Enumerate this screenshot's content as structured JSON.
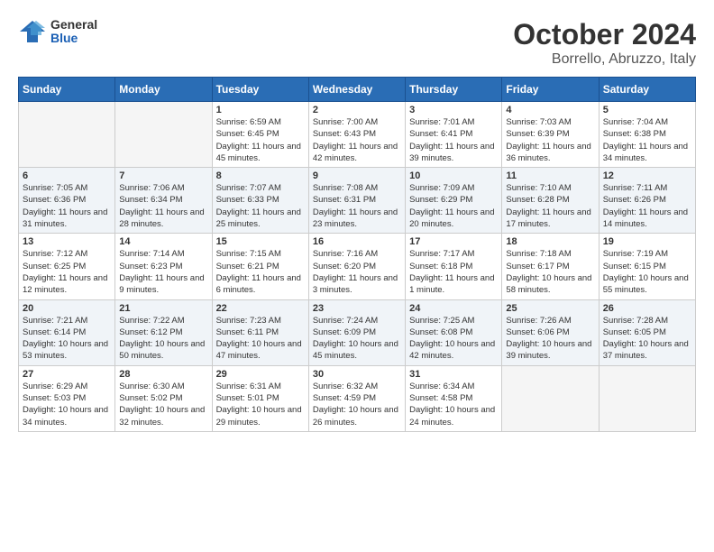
{
  "logo": {
    "general": "General",
    "blue": "Blue"
  },
  "header": {
    "month": "October 2024",
    "location": "Borrello, Abruzzo, Italy"
  },
  "weekdays": [
    "Sunday",
    "Monday",
    "Tuesday",
    "Wednesday",
    "Thursday",
    "Friday",
    "Saturday"
  ],
  "weeks": [
    [
      {
        "day": "",
        "empty": true
      },
      {
        "day": "",
        "empty": true
      },
      {
        "day": "1",
        "sunrise": "Sunrise: 6:59 AM",
        "sunset": "Sunset: 6:45 PM",
        "daylight": "Daylight: 11 hours and 45 minutes."
      },
      {
        "day": "2",
        "sunrise": "Sunrise: 7:00 AM",
        "sunset": "Sunset: 6:43 PM",
        "daylight": "Daylight: 11 hours and 42 minutes."
      },
      {
        "day": "3",
        "sunrise": "Sunrise: 7:01 AM",
        "sunset": "Sunset: 6:41 PM",
        "daylight": "Daylight: 11 hours and 39 minutes."
      },
      {
        "day": "4",
        "sunrise": "Sunrise: 7:03 AM",
        "sunset": "Sunset: 6:39 PM",
        "daylight": "Daylight: 11 hours and 36 minutes."
      },
      {
        "day": "5",
        "sunrise": "Sunrise: 7:04 AM",
        "sunset": "Sunset: 6:38 PM",
        "daylight": "Daylight: 11 hours and 34 minutes."
      }
    ],
    [
      {
        "day": "6",
        "sunrise": "Sunrise: 7:05 AM",
        "sunset": "Sunset: 6:36 PM",
        "daylight": "Daylight: 11 hours and 31 minutes."
      },
      {
        "day": "7",
        "sunrise": "Sunrise: 7:06 AM",
        "sunset": "Sunset: 6:34 PM",
        "daylight": "Daylight: 11 hours and 28 minutes."
      },
      {
        "day": "8",
        "sunrise": "Sunrise: 7:07 AM",
        "sunset": "Sunset: 6:33 PM",
        "daylight": "Daylight: 11 hours and 25 minutes."
      },
      {
        "day": "9",
        "sunrise": "Sunrise: 7:08 AM",
        "sunset": "Sunset: 6:31 PM",
        "daylight": "Daylight: 11 hours and 23 minutes."
      },
      {
        "day": "10",
        "sunrise": "Sunrise: 7:09 AM",
        "sunset": "Sunset: 6:29 PM",
        "daylight": "Daylight: 11 hours and 20 minutes."
      },
      {
        "day": "11",
        "sunrise": "Sunrise: 7:10 AM",
        "sunset": "Sunset: 6:28 PM",
        "daylight": "Daylight: 11 hours and 17 minutes."
      },
      {
        "day": "12",
        "sunrise": "Sunrise: 7:11 AM",
        "sunset": "Sunset: 6:26 PM",
        "daylight": "Daylight: 11 hours and 14 minutes."
      }
    ],
    [
      {
        "day": "13",
        "sunrise": "Sunrise: 7:12 AM",
        "sunset": "Sunset: 6:25 PM",
        "daylight": "Daylight: 11 hours and 12 minutes."
      },
      {
        "day": "14",
        "sunrise": "Sunrise: 7:14 AM",
        "sunset": "Sunset: 6:23 PM",
        "daylight": "Daylight: 11 hours and 9 minutes."
      },
      {
        "day": "15",
        "sunrise": "Sunrise: 7:15 AM",
        "sunset": "Sunset: 6:21 PM",
        "daylight": "Daylight: 11 hours and 6 minutes."
      },
      {
        "day": "16",
        "sunrise": "Sunrise: 7:16 AM",
        "sunset": "Sunset: 6:20 PM",
        "daylight": "Daylight: 11 hours and 3 minutes."
      },
      {
        "day": "17",
        "sunrise": "Sunrise: 7:17 AM",
        "sunset": "Sunset: 6:18 PM",
        "daylight": "Daylight: 11 hours and 1 minute."
      },
      {
        "day": "18",
        "sunrise": "Sunrise: 7:18 AM",
        "sunset": "Sunset: 6:17 PM",
        "daylight": "Daylight: 10 hours and 58 minutes."
      },
      {
        "day": "19",
        "sunrise": "Sunrise: 7:19 AM",
        "sunset": "Sunset: 6:15 PM",
        "daylight": "Daylight: 10 hours and 55 minutes."
      }
    ],
    [
      {
        "day": "20",
        "sunrise": "Sunrise: 7:21 AM",
        "sunset": "Sunset: 6:14 PM",
        "daylight": "Daylight: 10 hours and 53 minutes."
      },
      {
        "day": "21",
        "sunrise": "Sunrise: 7:22 AM",
        "sunset": "Sunset: 6:12 PM",
        "daylight": "Daylight: 10 hours and 50 minutes."
      },
      {
        "day": "22",
        "sunrise": "Sunrise: 7:23 AM",
        "sunset": "Sunset: 6:11 PM",
        "daylight": "Daylight: 10 hours and 47 minutes."
      },
      {
        "day": "23",
        "sunrise": "Sunrise: 7:24 AM",
        "sunset": "Sunset: 6:09 PM",
        "daylight": "Daylight: 10 hours and 45 minutes."
      },
      {
        "day": "24",
        "sunrise": "Sunrise: 7:25 AM",
        "sunset": "Sunset: 6:08 PM",
        "daylight": "Daylight: 10 hours and 42 minutes."
      },
      {
        "day": "25",
        "sunrise": "Sunrise: 7:26 AM",
        "sunset": "Sunset: 6:06 PM",
        "daylight": "Daylight: 10 hours and 39 minutes."
      },
      {
        "day": "26",
        "sunrise": "Sunrise: 7:28 AM",
        "sunset": "Sunset: 6:05 PM",
        "daylight": "Daylight: 10 hours and 37 minutes."
      }
    ],
    [
      {
        "day": "27",
        "sunrise": "Sunrise: 6:29 AM",
        "sunset": "Sunset: 5:03 PM",
        "daylight": "Daylight: 10 hours and 34 minutes."
      },
      {
        "day": "28",
        "sunrise": "Sunrise: 6:30 AM",
        "sunset": "Sunset: 5:02 PM",
        "daylight": "Daylight: 10 hours and 32 minutes."
      },
      {
        "day": "29",
        "sunrise": "Sunrise: 6:31 AM",
        "sunset": "Sunset: 5:01 PM",
        "daylight": "Daylight: 10 hours and 29 minutes."
      },
      {
        "day": "30",
        "sunrise": "Sunrise: 6:32 AM",
        "sunset": "Sunset: 4:59 PM",
        "daylight": "Daylight: 10 hours and 26 minutes."
      },
      {
        "day": "31",
        "sunrise": "Sunrise: 6:34 AM",
        "sunset": "Sunset: 4:58 PM",
        "daylight": "Daylight: 10 hours and 24 minutes."
      },
      {
        "day": "",
        "empty": true
      },
      {
        "day": "",
        "empty": true
      }
    ]
  ]
}
